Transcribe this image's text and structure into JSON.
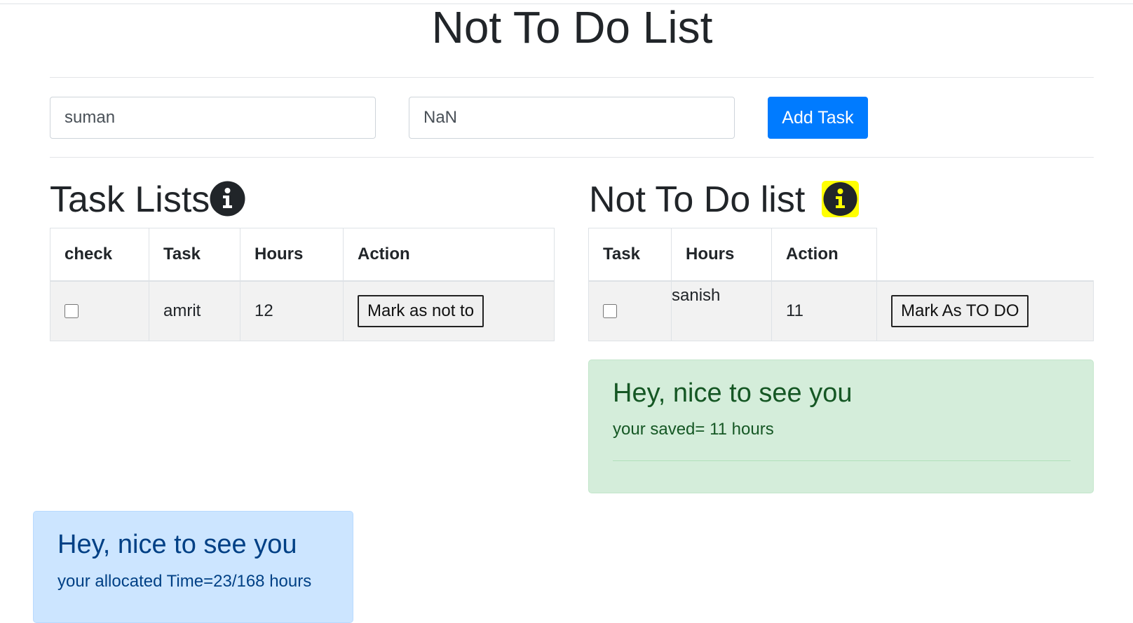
{
  "header": {
    "title": "Not To Do List"
  },
  "form": {
    "task_value": "suman",
    "hours_value": "NaN",
    "add_label": "Add Task"
  },
  "task_list": {
    "heading": "Task Lists",
    "icon": "info-icon",
    "columns": [
      "check",
      "Task",
      "Hours",
      "Action"
    ],
    "rows": [
      {
        "checked": false,
        "task": "amrit",
        "hours": "12",
        "action": "Mark as not to"
      }
    ]
  },
  "not_to_do": {
    "heading": "Not To Do list",
    "icon": "info-icon",
    "icon_highlight": "#ffff00",
    "columns": [
      "Task",
      "Hours",
      "Action"
    ],
    "rows": [
      {
        "checked": false,
        "task": "sanish",
        "hours": "11",
        "action": "Mark As TO DO"
      }
    ]
  },
  "saved_alert": {
    "heading": "Hey, nice to see you",
    "text": "your saved= 11 hours",
    "color": "#d4edda"
  },
  "allocated_alert": {
    "heading": "Hey, nice to see you",
    "text": "your allocated Time=23/168 hours",
    "color": "#cce5ff"
  },
  "colors": {
    "primary": "#007bff",
    "text": "#212529"
  }
}
